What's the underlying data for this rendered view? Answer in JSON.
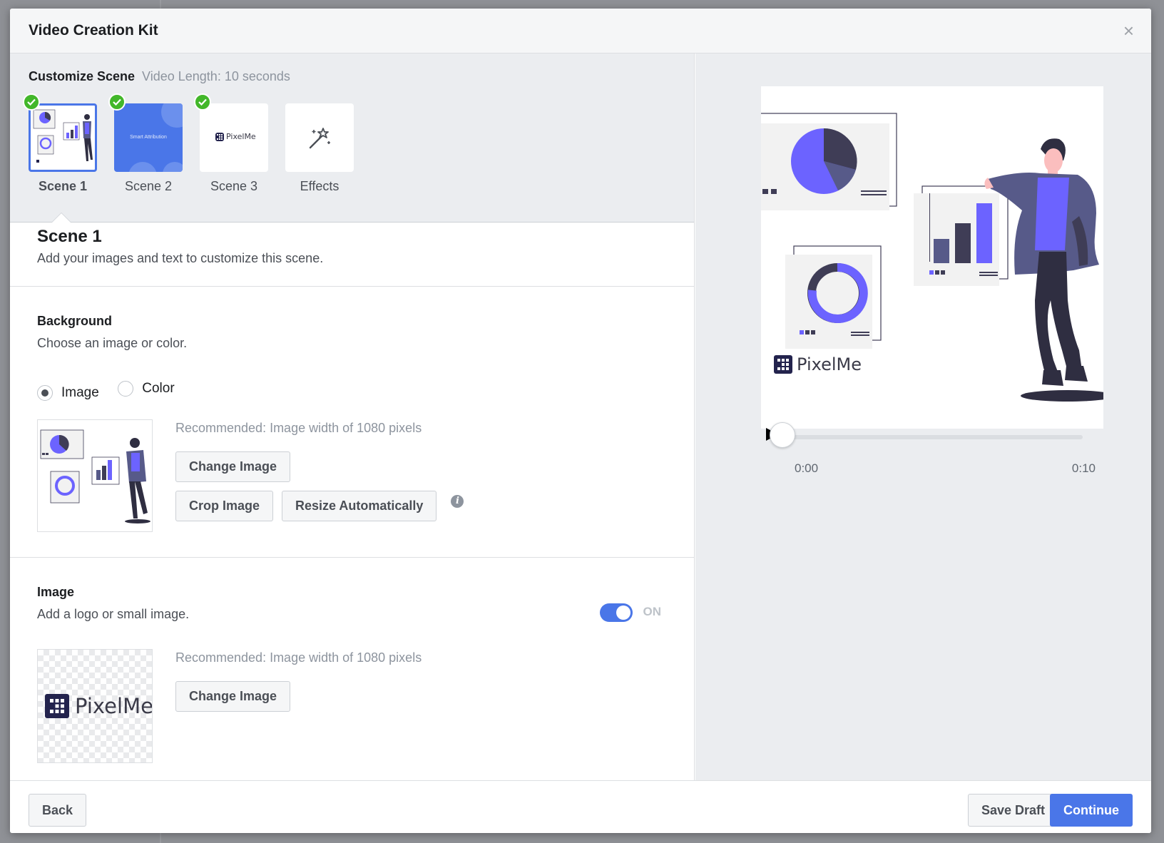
{
  "modal": {
    "title": "Video Creation Kit"
  },
  "customize": {
    "title": "Customize Scene",
    "length": "Video Length: 10 seconds",
    "scenes": [
      {
        "label": "Scene 1",
        "completed": true,
        "active": true
      },
      {
        "label": "Scene 2",
        "completed": true,
        "active": false,
        "thumb_text": "Smart Attribution"
      },
      {
        "label": "Scene 3",
        "completed": true,
        "active": false,
        "thumb_text": "PixelMe"
      },
      {
        "label": "Effects",
        "completed": false,
        "active": false,
        "icon": "magic-wand-icon"
      }
    ]
  },
  "scene_panel": {
    "title": "Scene 1",
    "description": "Add your images and text to customize this scene."
  },
  "background": {
    "title": "Background",
    "description": "Choose an image or color.",
    "options": [
      "Image",
      "Color"
    ],
    "selected": "Image",
    "recommended": "Recommended: Image width of 1080 pixels",
    "change_image": "Change Image",
    "crop_image": "Crop Image",
    "resize_auto": "Resize Automatically"
  },
  "image_section": {
    "title": "Image",
    "description": "Add a logo or small image.",
    "toggle_label": "ON",
    "recommended": "Recommended: Image width of 1080 pixels",
    "change_image": "Change Image",
    "logo_text": "PixelMe"
  },
  "preview": {
    "logo_text": "PixelMe",
    "time_start": "0:00",
    "time_end": "0:10",
    "progress": 0
  },
  "footer": {
    "back": "Back",
    "save_draft": "Save Draft",
    "continue": "Continue"
  },
  "colors": {
    "accent": "#4a76e8",
    "success": "#42b72a",
    "illustration": "#6c63ff",
    "dark": "#3f3d56"
  }
}
